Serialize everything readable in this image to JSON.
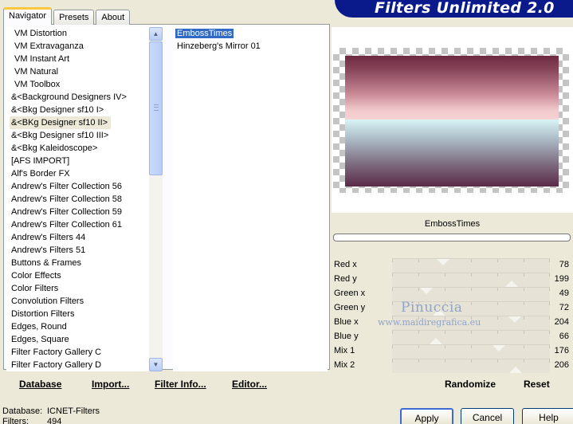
{
  "tabs": [
    {
      "label": "Navigator",
      "active": true
    },
    {
      "label": "Presets",
      "active": false
    },
    {
      "label": "About",
      "active": false
    }
  ],
  "banner": {
    "title": "Filters Unlimited 2.0"
  },
  "categories": [
    {
      "label": "VM Distortion",
      "indent": true
    },
    {
      "label": "VM Extravaganza",
      "indent": true
    },
    {
      "label": "VM Instant Art",
      "indent": true
    },
    {
      "label": "VM Natural",
      "indent": true
    },
    {
      "label": "VM Toolbox",
      "indent": true
    },
    {
      "label": "&<Background Designers IV>",
      "indent": false
    },
    {
      "label": "&<Bkg Designer sf10 I>",
      "indent": false
    },
    {
      "label": "&<BKg Designer sf10 II>",
      "indent": false,
      "selected": true
    },
    {
      "label": "&<Bkg Designer sf10 III>",
      "indent": false
    },
    {
      "label": "&<Bkg Kaleidoscope>",
      "indent": false
    },
    {
      "label": "[AFS IMPORT]",
      "indent": false
    },
    {
      "label": "Alf's Border FX",
      "indent": false
    },
    {
      "label": "Andrew's Filter Collection 56",
      "indent": false
    },
    {
      "label": "Andrew's Filter Collection 58",
      "indent": false
    },
    {
      "label": "Andrew's Filter Collection 59",
      "indent": false
    },
    {
      "label": "Andrew's Filter Collection 61",
      "indent": false
    },
    {
      "label": "Andrew's Filters 44",
      "indent": false
    },
    {
      "label": "Andrew's Filters 51",
      "indent": false
    },
    {
      "label": "Buttons & Frames",
      "indent": false
    },
    {
      "label": "Color Effects",
      "indent": false
    },
    {
      "label": "Color Filters",
      "indent": false
    },
    {
      "label": "Convolution Filters",
      "indent": false
    },
    {
      "label": "Distortion Filters",
      "indent": false
    },
    {
      "label": "Edges, Round",
      "indent": false
    },
    {
      "label": "Edges, Square",
      "indent": false
    },
    {
      "label": "Filter Factory Gallery C",
      "indent": false
    },
    {
      "label": "Filter Factory Gallery D",
      "indent": false
    }
  ],
  "filters": [
    {
      "label": "EmbossTimes",
      "selected": true
    },
    {
      "label": "Hinzeberg's Mirror 01",
      "selected": false
    }
  ],
  "left_buttons": {
    "database": "Database",
    "import": "Import...",
    "filter_info": "Filter Info...",
    "editor": "Editor..."
  },
  "preview": {
    "filter_name": "EmbossTimes"
  },
  "sliders": [
    {
      "label": "Red x",
      "value": 78
    },
    {
      "label": "Red y",
      "value": 199
    },
    {
      "label": "Green x",
      "value": 49
    },
    {
      "label": "Green y",
      "value": 72
    },
    {
      "label": "Blue x",
      "value": 204
    },
    {
      "label": "Blue y",
      "value": 66
    },
    {
      "label": "Mix 1",
      "value": 176
    },
    {
      "label": "Mix 2",
      "value": 206
    }
  ],
  "watermark": {
    "name": "Pinuccia",
    "site": "www.maidiregrafica.eu"
  },
  "right_buttons": {
    "randomize": "Randomize",
    "reset": "Reset"
  },
  "status": {
    "database_label": "Database:",
    "database_value": "ICNET-Filters",
    "filters_label": "Filters:",
    "filters_value": "494"
  },
  "dialog_buttons": {
    "apply": "Apply",
    "cancel": "Cancel",
    "help": "Help"
  },
  "icons": {
    "scroll_up": "scroll-up-arrow",
    "scroll_down": "scroll-down-arrow"
  },
  "colors": {
    "selection": "#316ac5",
    "banner": "#0a1a8a",
    "tab_accent": "#ffc83c"
  }
}
